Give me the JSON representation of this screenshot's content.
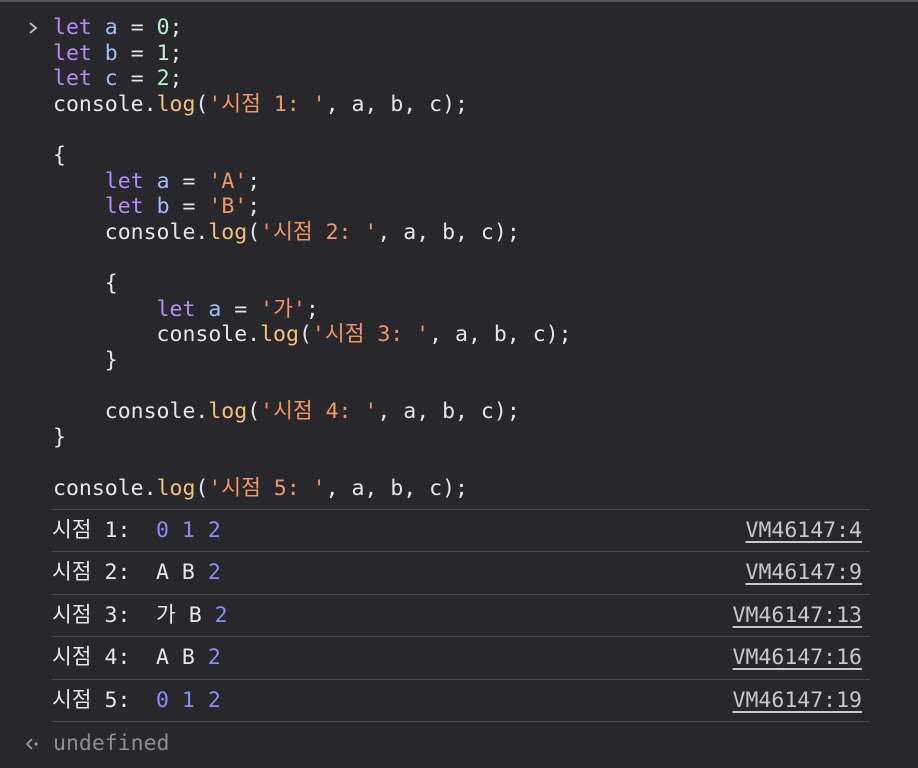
{
  "code": [
    [
      {
        "t": "let",
        "c": "kw"
      },
      {
        "t": " ",
        "c": "plain"
      },
      {
        "t": "a",
        "c": "var"
      },
      {
        "t": " = ",
        "c": "plain"
      },
      {
        "t": "0",
        "c": "num"
      },
      {
        "t": ";",
        "c": "plain"
      }
    ],
    [
      {
        "t": "let",
        "c": "kw"
      },
      {
        "t": " ",
        "c": "plain"
      },
      {
        "t": "b",
        "c": "var"
      },
      {
        "t": " = ",
        "c": "plain"
      },
      {
        "t": "1",
        "c": "num"
      },
      {
        "t": ";",
        "c": "plain"
      }
    ],
    [
      {
        "t": "let",
        "c": "kw"
      },
      {
        "t": " ",
        "c": "plain"
      },
      {
        "t": "c",
        "c": "var"
      },
      {
        "t": " = ",
        "c": "plain"
      },
      {
        "t": "2",
        "c": "num"
      },
      {
        "t": ";",
        "c": "plain"
      }
    ],
    [
      {
        "t": "console.",
        "c": "plain"
      },
      {
        "t": "log",
        "c": "fn"
      },
      {
        "t": "(",
        "c": "plain"
      },
      {
        "t": "'시점 1: '",
        "c": "str"
      },
      {
        "t": ", a, b, c);",
        "c": "plain"
      }
    ],
    [],
    [
      {
        "t": "{",
        "c": "plain"
      }
    ],
    [
      {
        "t": "    ",
        "c": "plain"
      },
      {
        "t": "let",
        "c": "kw"
      },
      {
        "t": " ",
        "c": "plain"
      },
      {
        "t": "a",
        "c": "var"
      },
      {
        "t": " = ",
        "c": "plain"
      },
      {
        "t": "'A'",
        "c": "str"
      },
      {
        "t": ";",
        "c": "plain"
      }
    ],
    [
      {
        "t": "    ",
        "c": "plain"
      },
      {
        "t": "let",
        "c": "kw"
      },
      {
        "t": " ",
        "c": "plain"
      },
      {
        "t": "b",
        "c": "var"
      },
      {
        "t": " = ",
        "c": "plain"
      },
      {
        "t": "'B'",
        "c": "str"
      },
      {
        "t": ";",
        "c": "plain"
      }
    ],
    [
      {
        "t": "    console.",
        "c": "plain"
      },
      {
        "t": "log",
        "c": "fn"
      },
      {
        "t": "(",
        "c": "plain"
      },
      {
        "t": "'시점 2: '",
        "c": "str"
      },
      {
        "t": ", a, b, c);",
        "c": "plain"
      }
    ],
    [],
    [
      {
        "t": "    {",
        "c": "plain"
      }
    ],
    [
      {
        "t": "        ",
        "c": "plain"
      },
      {
        "t": "let",
        "c": "kw"
      },
      {
        "t": " ",
        "c": "plain"
      },
      {
        "t": "a",
        "c": "var"
      },
      {
        "t": " = ",
        "c": "plain"
      },
      {
        "t": "'가'",
        "c": "str"
      },
      {
        "t": ";",
        "c": "plain"
      }
    ],
    [
      {
        "t": "        console.",
        "c": "plain"
      },
      {
        "t": "log",
        "c": "fn"
      },
      {
        "t": "(",
        "c": "plain"
      },
      {
        "t": "'시점 3: '",
        "c": "str"
      },
      {
        "t": ", a, b, c);",
        "c": "plain"
      }
    ],
    [
      {
        "t": "    }",
        "c": "plain"
      }
    ],
    [],
    [
      {
        "t": "    console.",
        "c": "plain"
      },
      {
        "t": "log",
        "c": "fn"
      },
      {
        "t": "(",
        "c": "plain"
      },
      {
        "t": "'시점 4: '",
        "c": "str"
      },
      {
        "t": ", a, b, c);",
        "c": "plain"
      }
    ],
    [
      {
        "t": "}",
        "c": "plain"
      }
    ],
    [],
    [
      {
        "t": "console.",
        "c": "plain"
      },
      {
        "t": "log",
        "c": "fn"
      },
      {
        "t": "(",
        "c": "plain"
      },
      {
        "t": "'시점 5: '",
        "c": "str"
      },
      {
        "t": ", a, b, c);",
        "c": "plain"
      }
    ]
  ],
  "logs": [
    {
      "label": "시점 1:",
      "values": [
        {
          "v": "0",
          "k": "num"
        },
        {
          "v": "1",
          "k": "num"
        },
        {
          "v": "2",
          "k": "num"
        }
      ],
      "source": "VM46147:4"
    },
    {
      "label": "시점 2:",
      "values": [
        {
          "v": "A",
          "k": "str"
        },
        {
          "v": "B",
          "k": "str"
        },
        {
          "v": "2",
          "k": "num"
        }
      ],
      "source": "VM46147:9"
    },
    {
      "label": "시점 3:",
      "values": [
        {
          "v": "가",
          "k": "str"
        },
        {
          "v": "B",
          "k": "str"
        },
        {
          "v": "2",
          "k": "num"
        }
      ],
      "source": "VM46147:13"
    },
    {
      "label": "시점 4:",
      "values": [
        {
          "v": "A",
          "k": "str"
        },
        {
          "v": "B",
          "k": "str"
        },
        {
          "v": "2",
          "k": "num"
        }
      ],
      "source": "VM46147:16"
    },
    {
      "label": "시점 5:",
      "values": [
        {
          "v": "0",
          "k": "num"
        },
        {
          "v": "1",
          "k": "num"
        },
        {
          "v": "2",
          "k": "num"
        }
      ],
      "source": "VM46147:19"
    }
  ],
  "result": {
    "text": "undefined",
    "icon": "return-arrow-icon"
  },
  "prompt": {
    "icon": "chevron-right-icon"
  },
  "colors": {
    "background": "#28282c",
    "keyword": "#b68cf5",
    "variable": "#9ac1f8",
    "number": "#baf2c7",
    "string": "#f29668",
    "function": "#f2c279",
    "log_number": "#8e8cf5"
  }
}
